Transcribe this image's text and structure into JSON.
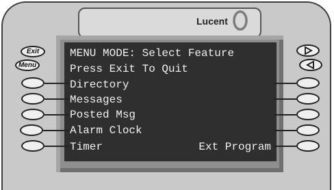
{
  "brand": {
    "name": "Lucent"
  },
  "screen": {
    "lines": [
      "MENU MODE: Select Feature",
      "Press Exit To Quit",
      "Directory",
      "Messages",
      "Posted Msg",
      "Alarm Clock",
      "Timer"
    ],
    "right_line": "Ext Program"
  },
  "buttons": {
    "exit_label": "Exit",
    "menu_label": "Menu"
  },
  "icons": {
    "forward": "triangle-right-icon",
    "back": "triangle-left-icon",
    "logo": "lucent-ring-icon"
  }
}
